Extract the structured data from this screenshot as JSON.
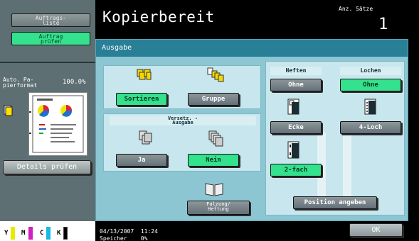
{
  "sidebar": {
    "job_list_label": "Auftrags-\nliste",
    "check_job_label": "Auftrag\nprüfen",
    "zoom_label": "Auto. Pa-\npierformat",
    "zoom_value": "100.0%",
    "details_label": "Details prüfen",
    "toner": [
      "Y",
      "M",
      "C",
      "K"
    ],
    "toner_colors": [
      "#e8e800",
      "#d020c0",
      "#18b8e8",
      "#000000"
    ]
  },
  "header": {
    "title": "Kopierbereit",
    "count_label": "Anz. Sätze",
    "count_value": "1"
  },
  "panel": {
    "title": "Ausgabe",
    "sort_label": "Sortieren",
    "group_label": "Gruppe",
    "offset_label": "Versetz. -\nAusgabe",
    "offset_yes": "Ja",
    "offset_no": "Nein",
    "fold_label": "Falzung/\nHeftung",
    "staple_header": "Heften",
    "punch_header": "Lochen",
    "staple_off": "Ohne",
    "punch_off": "Ohne",
    "staple_corner": "Ecke",
    "punch_4hole": "4-Loch",
    "staple_2pos": "2-fach",
    "position_label": "Position angeben"
  },
  "footer": {
    "date": "04/13/2007",
    "time": "11:24",
    "memory_label": "Speicher",
    "memory_value": "0%",
    "ok_label": "OK"
  },
  "colors": {
    "selected": "#34e18d",
    "panel_title": "#287f96",
    "panel_body": "#8cc6d2"
  }
}
